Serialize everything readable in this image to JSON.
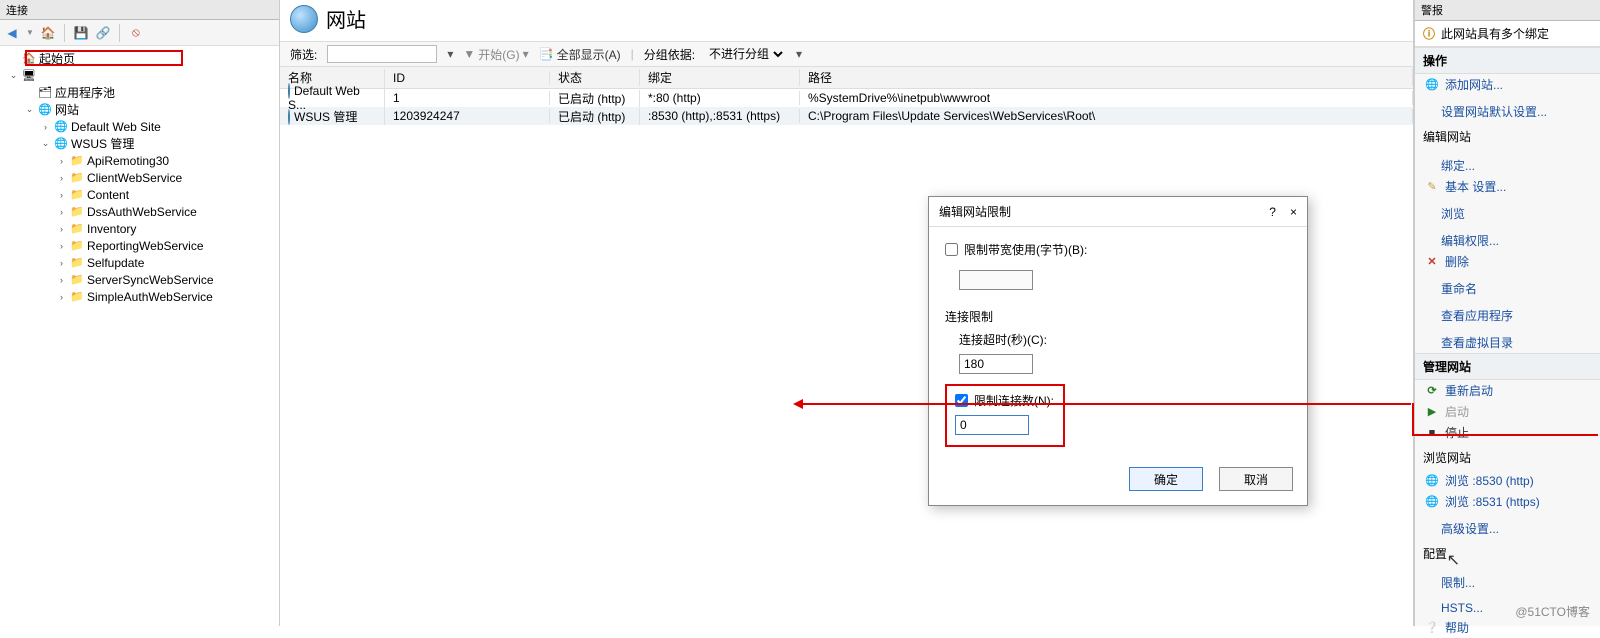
{
  "left": {
    "header": "连接",
    "toolbar": [
      "back",
      "fwd",
      "sep",
      "house",
      "refresh",
      "sep",
      "save",
      "sep",
      "help"
    ],
    "tree": [
      {
        "depth": 0,
        "exp": "",
        "icon": "home",
        "label": "起始页"
      },
      {
        "depth": 0,
        "exp": "v",
        "icon": "server",
        "label": ""
      },
      {
        "depth": 1,
        "exp": "",
        "icon": "pool",
        "label": "应用程序池"
      },
      {
        "depth": 1,
        "exp": "v",
        "icon": "sites",
        "label": "网站"
      },
      {
        "depth": 2,
        "exp": ">",
        "icon": "site",
        "label": "Default Web Site"
      },
      {
        "depth": 2,
        "exp": "v",
        "icon": "site",
        "label": "WSUS 管理"
      },
      {
        "depth": 3,
        "exp": ">",
        "icon": "app",
        "label": "ApiRemoting30"
      },
      {
        "depth": 3,
        "exp": ">",
        "icon": "app",
        "label": "ClientWebService"
      },
      {
        "depth": 3,
        "exp": ">",
        "icon": "app",
        "label": "Content"
      },
      {
        "depth": 3,
        "exp": ">",
        "icon": "app",
        "label": "DssAuthWebService"
      },
      {
        "depth": 3,
        "exp": ">",
        "icon": "app",
        "label": "Inventory"
      },
      {
        "depth": 3,
        "exp": ">",
        "icon": "app",
        "label": "ReportingWebService"
      },
      {
        "depth": 3,
        "exp": ">",
        "icon": "app",
        "label": "Selfupdate"
      },
      {
        "depth": 3,
        "exp": ">",
        "icon": "app",
        "label": "ServerSyncWebService"
      },
      {
        "depth": 3,
        "exp": ">",
        "icon": "app",
        "label": "SimpleAuthWebService"
      }
    ]
  },
  "center": {
    "title": "网站",
    "filter": {
      "label": "筛选:",
      "start": "开始(G)",
      "showall": "全部显示(A)",
      "group_label": "分组依据:",
      "group_value": "不进行分组"
    },
    "columns": {
      "name": "名称",
      "id": "ID",
      "status": "状态",
      "bind": "绑定",
      "path": "路径"
    },
    "rows": [
      {
        "name": "Default Web S...",
        "id": "1",
        "status": "已启动 (http)",
        "bind": "*:80 (http)",
        "path": "%SystemDrive%\\inetpub\\wwwroot"
      },
      {
        "name": "WSUS 管理",
        "id": "1203924247",
        "status": "已启动 (http)",
        "bind": ":8530 (http),:8531 (https)",
        "path": "C:\\Program Files\\Update Services\\WebServices\\Root\\"
      }
    ]
  },
  "dialog": {
    "title": "编辑网站限制",
    "help": "?",
    "close": "×",
    "bandwidth_label": "限制带宽使用(字节)(B):",
    "bandwidth_value": "",
    "conn_group": "连接限制",
    "timeout_label": "连接超时(秒)(C):",
    "timeout_value": "180",
    "limit_conn_label": "限制连接数(N):",
    "limit_conn_value": "0",
    "ok": "确定",
    "cancel": "取消"
  },
  "right": {
    "header": "警报",
    "alert": "此网站具有多个绑定",
    "actions_title": "操作",
    "add_site": "添加网站...",
    "set_defaults": "设置网站默认设置...",
    "edit_site_title": "编辑网站",
    "bindings": "绑定...",
    "basic": "基本 设置...",
    "explore": "浏览",
    "edit_perm": "编辑权限...",
    "remove": "删除",
    "rename": "重命名",
    "view_apps": "查看应用程序",
    "view_vdirs": "查看虚拟目录",
    "manage_title": "管理网站",
    "restart": "重新启动",
    "start": "启动",
    "stop": "停止",
    "browse_title": "浏览网站",
    "browse1": "浏览 :8530 (http)",
    "browse2": "浏览 :8531 (https)",
    "adv": "高级设置...",
    "config_title": "配置",
    "limits": "限制...",
    "hsts": "HSTS...",
    "help": "帮助"
  },
  "watermark": "@51CTO博客"
}
